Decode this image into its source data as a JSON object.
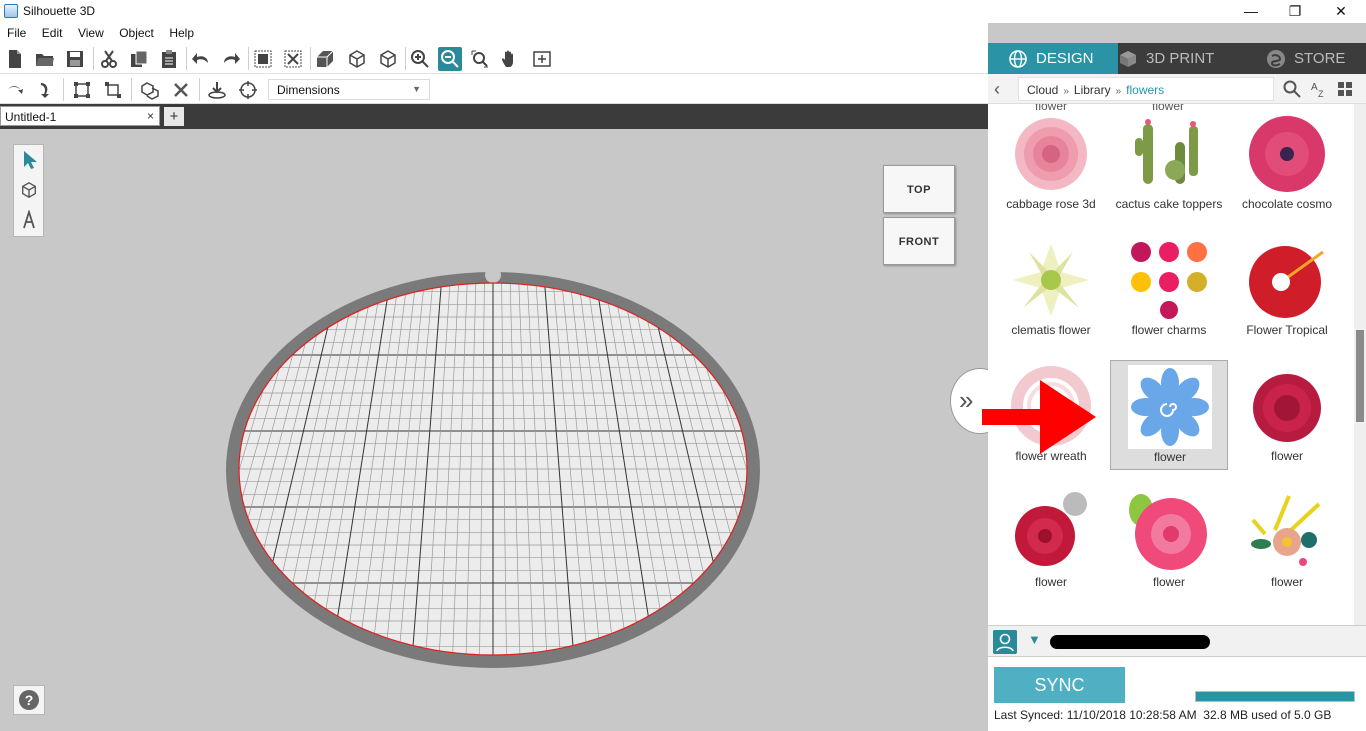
{
  "window": {
    "title": "Silhouette 3D",
    "minimize": "—",
    "maximize": "❐",
    "close": "✕"
  },
  "menu": [
    "File",
    "Edit",
    "View",
    "Object",
    "Help"
  ],
  "toolbar2": {
    "dimensions_label": "Dimensions"
  },
  "document_tab": {
    "name": "Untitled-1",
    "close": "×",
    "add": "+"
  },
  "viewcube": {
    "top": "TOP",
    "front": "FRONT"
  },
  "panel_tabs": [
    {
      "label": "DESIGN",
      "icon": "globe-icon",
      "active": true
    },
    {
      "label": "3D PRINT",
      "icon": "box-icon",
      "active": false
    },
    {
      "label": "STORE",
      "icon": "store-icon",
      "active": false
    }
  ],
  "breadcrumb": [
    "Cloud",
    "Library",
    "flowers"
  ],
  "library": {
    "partial_captions": [
      "flower",
      "flower"
    ],
    "items": [
      {
        "caption": "cabbage rose 3d",
        "icon": "cabbage-rose-thumbnail"
      },
      {
        "caption": "cactus cake toppers",
        "icon": "cactus-thumbnail"
      },
      {
        "caption": "chocolate cosmo",
        "icon": "cosmo-thumbnail"
      },
      {
        "caption": "clematis flower",
        "icon": "clematis-thumbnail"
      },
      {
        "caption": "flower charms",
        "icon": "charms-thumbnail"
      },
      {
        "caption": "Flower Tropical",
        "icon": "hibiscus-thumbnail"
      },
      {
        "caption": "flower wreath",
        "icon": "wreath-thumbnail"
      },
      {
        "caption": "flower",
        "icon": "blue-flower-thumbnail",
        "selected": true
      },
      {
        "caption": "flower",
        "icon": "red-rose-thumbnail"
      },
      {
        "caption": "flower",
        "icon": "red-dahlia-thumbnail"
      },
      {
        "caption": "flower",
        "icon": "pink-flower-thumbnail"
      },
      {
        "caption": "flower",
        "icon": "bouquet-thumbnail"
      }
    ]
  },
  "sync": {
    "button": "SYNC",
    "last_synced": "Last Synced: 11/10/2018 10:28:58 AM",
    "storage": "32.8 MB used of 5.0 GB",
    "storage_fraction": 0.0066
  },
  "colors": {
    "accent": "#2a94a6",
    "sync": "#4fb0c3",
    "arrow": "#ff0000"
  }
}
